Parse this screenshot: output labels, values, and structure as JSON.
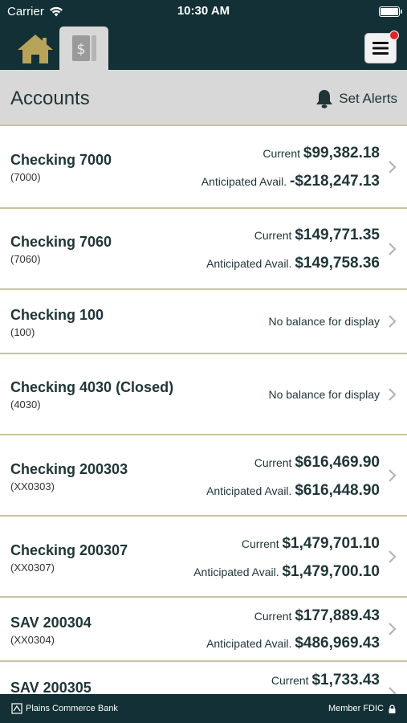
{
  "status": {
    "carrier": "Carrier",
    "time": "10:30 AM"
  },
  "header": {
    "tabs": [
      "home",
      "accounts"
    ]
  },
  "title_bar": {
    "title": "Accounts",
    "alerts_label": "Set Alerts"
  },
  "accounts": [
    {
      "name": "Checking 7000",
      "number": "(7000)",
      "current_label": "Current",
      "current": "$99,382.18",
      "anticipated_label": "Anticipated Avail.",
      "anticipated": "-$218,247.13"
    },
    {
      "name": "Checking 7060",
      "number": "(7060)",
      "current_label": "Current",
      "current": "$149,771.35",
      "anticipated_label": "Anticipated Avail.",
      "anticipated": "$149,758.36"
    },
    {
      "name": "Checking 100",
      "number": "(100)",
      "no_balance": "No balance for display"
    },
    {
      "name": "Checking 4030 (Closed)",
      "number": "(4030)",
      "no_balance": "No balance for display"
    },
    {
      "name": "Checking 200303",
      "number": "(XX0303)",
      "current_label": "Current",
      "current": "$616,469.90",
      "anticipated_label": "Anticipated Avail.",
      "anticipated": "$616,448.90"
    },
    {
      "name": "Checking 200307",
      "number": "(XX0307)",
      "current_label": "Current",
      "current": "$1,479,701.10",
      "anticipated_label": "Anticipated Avail.",
      "anticipated": "$1,479,700.10"
    },
    {
      "name": "SAV 200304",
      "number": "(XX0304)",
      "current_label": "Current",
      "current": "$177,889.43",
      "anticipated_label": "Anticipated Avail.",
      "anticipated": "$486,969.43"
    },
    {
      "name": "SAV 200305",
      "current_label": "Current",
      "current": "$1,733.43"
    }
  ],
  "footer": {
    "bank_name": "Plains Commerce Bank",
    "fdic": "Member FDIC"
  },
  "colors": {
    "header_bg": "#123035",
    "title_bg": "#d8d8d8",
    "divider": "#c8c59a",
    "home_icon": "#b8a35a",
    "badge": "#e2232a"
  }
}
